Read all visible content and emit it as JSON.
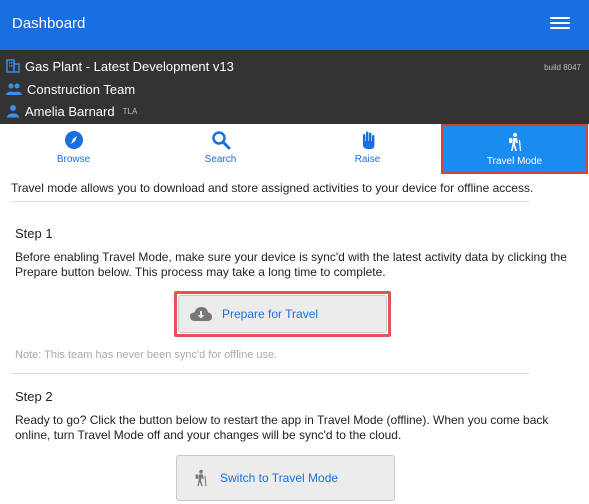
{
  "header": {
    "title": "Dashboard",
    "menu_icon": "hamburger-icon"
  },
  "context": {
    "project": "Gas Plant - Latest Development v13",
    "team": "Construction Team",
    "user": "Amelia Barnard",
    "user_tag": "TLA",
    "build": "build 8047"
  },
  "tabs": [
    {
      "label": "Browse",
      "icon": "compass-icon"
    },
    {
      "label": "Search",
      "icon": "search-icon"
    },
    {
      "label": "Raise",
      "icon": "hand-icon"
    },
    {
      "label": "Travel Mode",
      "icon": "hiker-icon",
      "active": true
    }
  ],
  "intro": "Travel mode allows you to download and store assigned activities to your device for offline access.",
  "step1": {
    "heading": "Step 1",
    "text": "Before enabling Travel Mode, make sure your device is sync'd with the latest activity data by clicking the Prepare button below. This process may take a long time to complete.",
    "button": "Prepare for Travel",
    "note": "Note: This team has never been sync'd for offline use."
  },
  "step2": {
    "heading": "Step 2",
    "text": "Ready to go? Click the button below to restart the app in Travel Mode (offline). When you come back online, turn Travel Mode off and your changes will be sync'd to the cloud.",
    "button": "Switch to Travel Mode"
  },
  "colors": {
    "primary": "#1a6fe0",
    "header_bg": "#333333",
    "highlight": "#e05652",
    "active_tab": "#1a8cf0"
  }
}
